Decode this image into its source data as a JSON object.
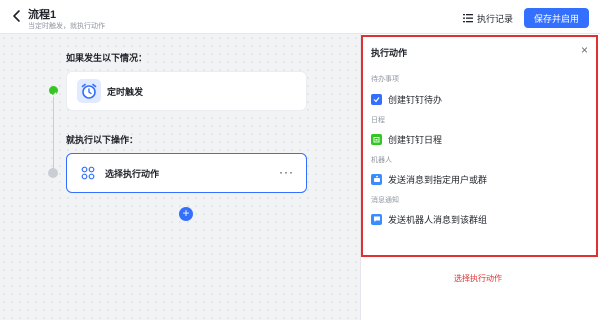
{
  "header": {
    "title": "流程1",
    "subtitle": "当定时触发，就执行动作",
    "log_label": "执行记录",
    "save_label": "保存并启用",
    "accent": "#3370ff"
  },
  "canvas": {
    "trigger_section": "如果发生以下情况：",
    "trigger_card_label": "定时触发",
    "action_section": "就执行以下操作：",
    "action_card_label": "选择执行动作",
    "more_glyph": "···",
    "add_glyph": "+"
  },
  "panel": {
    "title": "执行动作",
    "close_glyph": "×",
    "groups": [
      {
        "label": "待办事项",
        "item": "创建钉钉待办",
        "icon": "todo-icon",
        "color": "#3370ff"
      },
      {
        "label": "日程",
        "item": "创建钉钉日程",
        "icon": "calendar-icon",
        "color": "#34c724"
      },
      {
        "label": "机器人",
        "item": "发送消息到指定用户或群",
        "icon": "robot-icon",
        "color": "#3c8cff"
      },
      {
        "label": "消息通知",
        "item": "发送机器人消息到该群组",
        "icon": "chat-icon",
        "color": "#3c8cff"
      }
    ],
    "caption": "选择执行动作",
    "highlight_color": "#e03131"
  }
}
